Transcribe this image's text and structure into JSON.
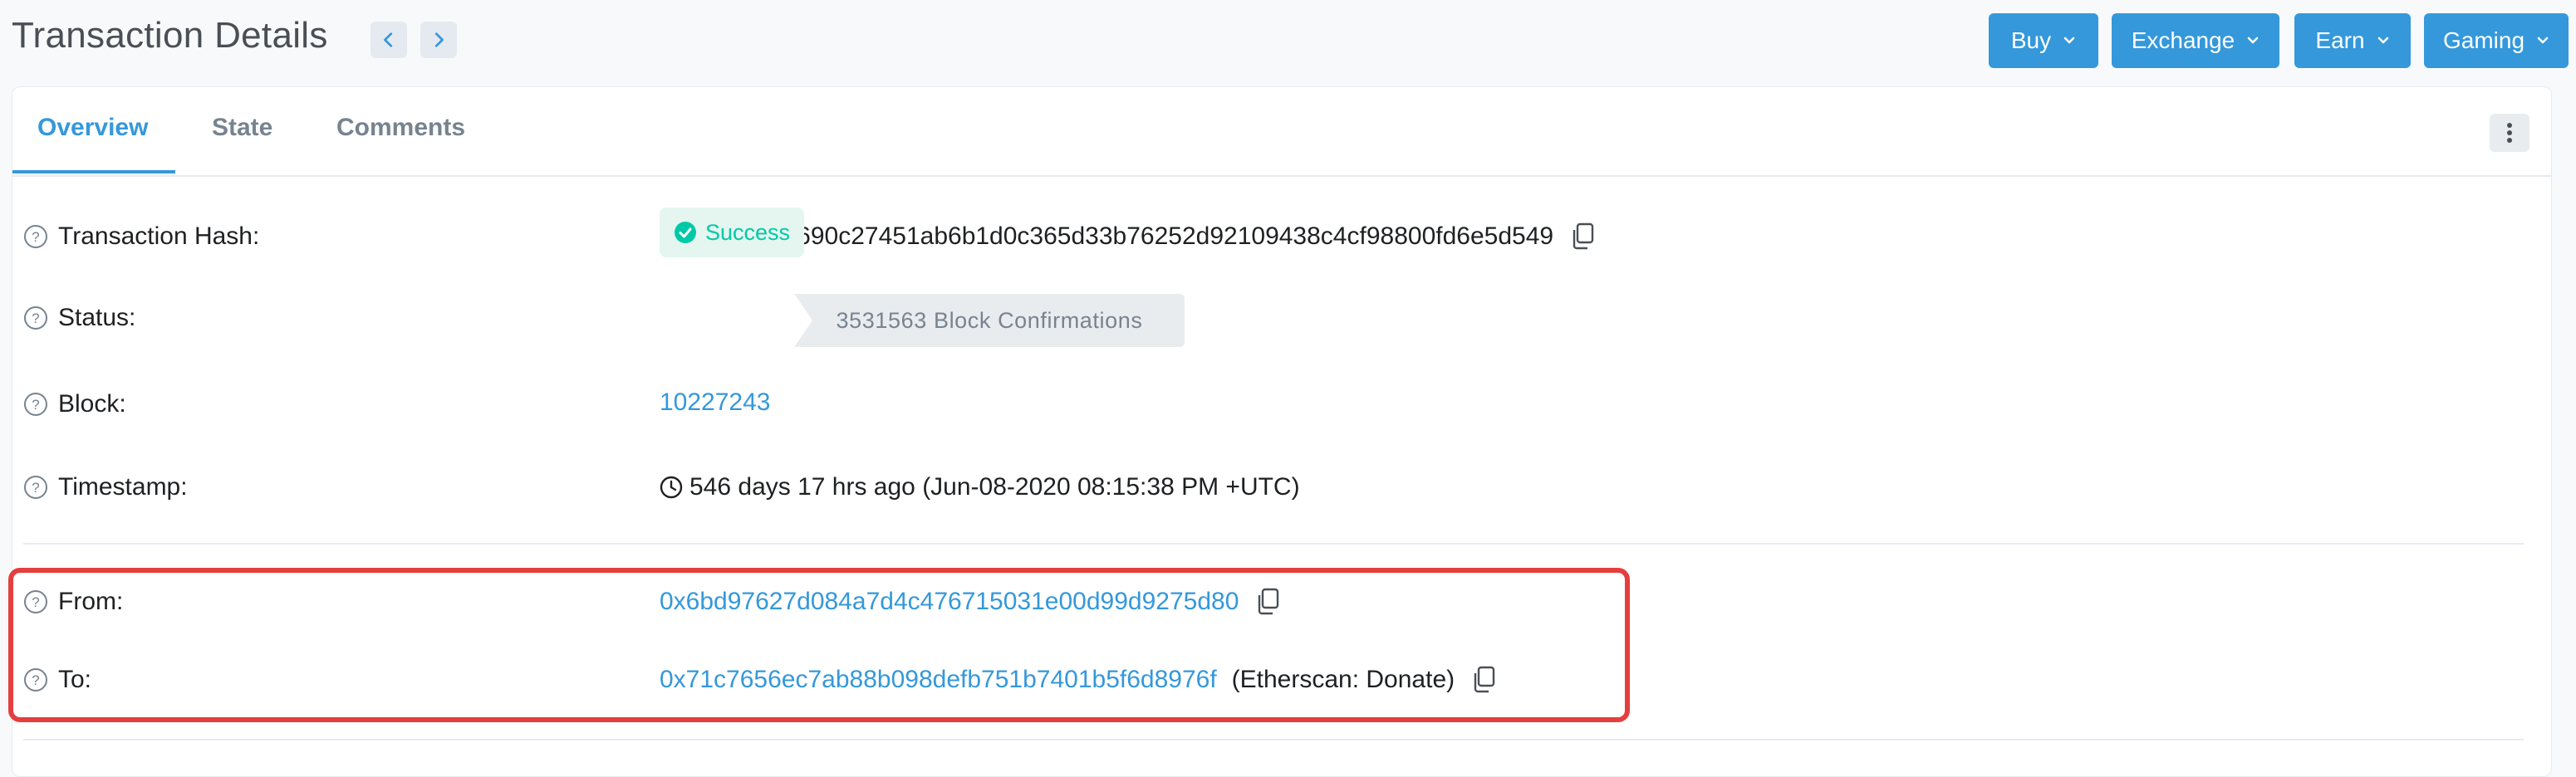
{
  "header": {
    "title": "Transaction Details",
    "menus": [
      "Buy",
      "Exchange",
      "Earn",
      "Gaming"
    ]
  },
  "tabs": [
    "Overview",
    "State",
    "Comments"
  ],
  "details": {
    "tx_hash_label": "Transaction Hash:",
    "tx_hash": "0x90545860690c27451ab6b1d0c365d33b76252d92109438c4cf98800fd6e5d549",
    "status_label": "Status:",
    "status": "Success",
    "block_label": "Block:",
    "block": "10227243",
    "confirmations": "3531563 Block Confirmations",
    "timestamp_label": "Timestamp:",
    "timestamp": "546 days 17 hrs ago (Jun-08-2020 08:15:38 PM +UTC)",
    "from_label": "From:",
    "from": "0x6bd97627d084a7d4c476715031e00d99d9275d80",
    "to_label": "To:",
    "to": "0x71c7656ec7ab88b098defb751b7401b5f6d8976f",
    "to_name": "(Etherscan: Donate)"
  },
  "colors": {
    "accent": "#3498db",
    "success": "#00c9a7",
    "highlight": "#e53e3e"
  }
}
